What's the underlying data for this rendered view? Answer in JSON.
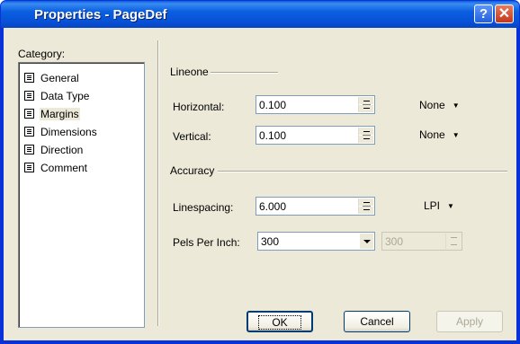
{
  "window": {
    "title": "Properties - PageDef",
    "help_label": "?",
    "close_label": "✕"
  },
  "category": {
    "label": "Category:",
    "items": [
      {
        "label": "General",
        "selected": false
      },
      {
        "label": "Data Type",
        "selected": false
      },
      {
        "label": "Margins",
        "selected": true
      },
      {
        "label": "Dimensions",
        "selected": false
      },
      {
        "label": "Direction",
        "selected": false
      },
      {
        "label": "Comment",
        "selected": false
      }
    ]
  },
  "lineone": {
    "group_label": "Lineone",
    "horizontal": {
      "label": "Horizontal:",
      "value": "0.100",
      "unit": "None"
    },
    "vertical": {
      "label": "Vertical:",
      "value": "0.100",
      "unit": "None"
    }
  },
  "accuracy": {
    "group_label": "Accuracy",
    "linespacing": {
      "label": "Linespacing:",
      "value": "6.000",
      "unit": "LPI"
    },
    "pels": {
      "label": "Pels Per Inch:",
      "value": "300",
      "disabled_value": "300"
    }
  },
  "buttons": {
    "ok": "OK",
    "cancel": "Cancel",
    "apply": "Apply"
  }
}
